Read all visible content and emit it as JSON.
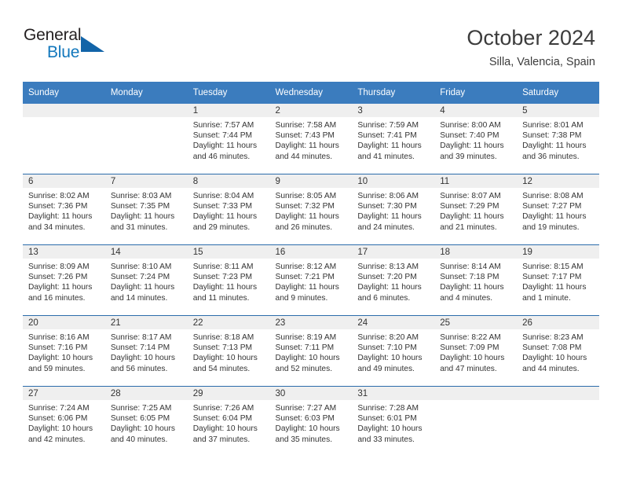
{
  "brand": {
    "name_top": "General",
    "name_bottom": "Blue",
    "color_top": "#231f20",
    "color_bottom": "#1277bc",
    "triangle_color": "#1264a8"
  },
  "header": {
    "title": "October 2024",
    "location": "Silla, Valencia, Spain"
  },
  "theme": {
    "header_bg": "#3b7cbe",
    "row_divider": "#2b6cab",
    "daynum_band_bg": "#efefef",
    "text": "#333333"
  },
  "weekdays": [
    "Sunday",
    "Monday",
    "Tuesday",
    "Wednesday",
    "Thursday",
    "Friday",
    "Saturday"
  ],
  "weeks": [
    [
      {
        "day": "",
        "sunrise": "",
        "sunset": "",
        "daylight_line1": "",
        "daylight_line2": ""
      },
      {
        "day": "",
        "sunrise": "",
        "sunset": "",
        "daylight_line1": "",
        "daylight_line2": ""
      },
      {
        "day": "1",
        "sunrise": "Sunrise: 7:57 AM",
        "sunset": "Sunset: 7:44 PM",
        "daylight_line1": "Daylight: 11 hours",
        "daylight_line2": "and 46 minutes."
      },
      {
        "day": "2",
        "sunrise": "Sunrise: 7:58 AM",
        "sunset": "Sunset: 7:43 PM",
        "daylight_line1": "Daylight: 11 hours",
        "daylight_line2": "and 44 minutes."
      },
      {
        "day": "3",
        "sunrise": "Sunrise: 7:59 AM",
        "sunset": "Sunset: 7:41 PM",
        "daylight_line1": "Daylight: 11 hours",
        "daylight_line2": "and 41 minutes."
      },
      {
        "day": "4",
        "sunrise": "Sunrise: 8:00 AM",
        "sunset": "Sunset: 7:40 PM",
        "daylight_line1": "Daylight: 11 hours",
        "daylight_line2": "and 39 minutes."
      },
      {
        "day": "5",
        "sunrise": "Sunrise: 8:01 AM",
        "sunset": "Sunset: 7:38 PM",
        "daylight_line1": "Daylight: 11 hours",
        "daylight_line2": "and 36 minutes."
      }
    ],
    [
      {
        "day": "6",
        "sunrise": "Sunrise: 8:02 AM",
        "sunset": "Sunset: 7:36 PM",
        "daylight_line1": "Daylight: 11 hours",
        "daylight_line2": "and 34 minutes."
      },
      {
        "day": "7",
        "sunrise": "Sunrise: 8:03 AM",
        "sunset": "Sunset: 7:35 PM",
        "daylight_line1": "Daylight: 11 hours",
        "daylight_line2": "and 31 minutes."
      },
      {
        "day": "8",
        "sunrise": "Sunrise: 8:04 AM",
        "sunset": "Sunset: 7:33 PM",
        "daylight_line1": "Daylight: 11 hours",
        "daylight_line2": "and 29 minutes."
      },
      {
        "day": "9",
        "sunrise": "Sunrise: 8:05 AM",
        "sunset": "Sunset: 7:32 PM",
        "daylight_line1": "Daylight: 11 hours",
        "daylight_line2": "and 26 minutes."
      },
      {
        "day": "10",
        "sunrise": "Sunrise: 8:06 AM",
        "sunset": "Sunset: 7:30 PM",
        "daylight_line1": "Daylight: 11 hours",
        "daylight_line2": "and 24 minutes."
      },
      {
        "day": "11",
        "sunrise": "Sunrise: 8:07 AM",
        "sunset": "Sunset: 7:29 PM",
        "daylight_line1": "Daylight: 11 hours",
        "daylight_line2": "and 21 minutes."
      },
      {
        "day": "12",
        "sunrise": "Sunrise: 8:08 AM",
        "sunset": "Sunset: 7:27 PM",
        "daylight_line1": "Daylight: 11 hours",
        "daylight_line2": "and 19 minutes."
      }
    ],
    [
      {
        "day": "13",
        "sunrise": "Sunrise: 8:09 AM",
        "sunset": "Sunset: 7:26 PM",
        "daylight_line1": "Daylight: 11 hours",
        "daylight_line2": "and 16 minutes."
      },
      {
        "day": "14",
        "sunrise": "Sunrise: 8:10 AM",
        "sunset": "Sunset: 7:24 PM",
        "daylight_line1": "Daylight: 11 hours",
        "daylight_line2": "and 14 minutes."
      },
      {
        "day": "15",
        "sunrise": "Sunrise: 8:11 AM",
        "sunset": "Sunset: 7:23 PM",
        "daylight_line1": "Daylight: 11 hours",
        "daylight_line2": "and 11 minutes."
      },
      {
        "day": "16",
        "sunrise": "Sunrise: 8:12 AM",
        "sunset": "Sunset: 7:21 PM",
        "daylight_line1": "Daylight: 11 hours",
        "daylight_line2": "and 9 minutes."
      },
      {
        "day": "17",
        "sunrise": "Sunrise: 8:13 AM",
        "sunset": "Sunset: 7:20 PM",
        "daylight_line1": "Daylight: 11 hours",
        "daylight_line2": "and 6 minutes."
      },
      {
        "day": "18",
        "sunrise": "Sunrise: 8:14 AM",
        "sunset": "Sunset: 7:18 PM",
        "daylight_line1": "Daylight: 11 hours",
        "daylight_line2": "and 4 minutes."
      },
      {
        "day": "19",
        "sunrise": "Sunrise: 8:15 AM",
        "sunset": "Sunset: 7:17 PM",
        "daylight_line1": "Daylight: 11 hours",
        "daylight_line2": "and 1 minute."
      }
    ],
    [
      {
        "day": "20",
        "sunrise": "Sunrise: 8:16 AM",
        "sunset": "Sunset: 7:16 PM",
        "daylight_line1": "Daylight: 10 hours",
        "daylight_line2": "and 59 minutes."
      },
      {
        "day": "21",
        "sunrise": "Sunrise: 8:17 AM",
        "sunset": "Sunset: 7:14 PM",
        "daylight_line1": "Daylight: 10 hours",
        "daylight_line2": "and 56 minutes."
      },
      {
        "day": "22",
        "sunrise": "Sunrise: 8:18 AM",
        "sunset": "Sunset: 7:13 PM",
        "daylight_line1": "Daylight: 10 hours",
        "daylight_line2": "and 54 minutes."
      },
      {
        "day": "23",
        "sunrise": "Sunrise: 8:19 AM",
        "sunset": "Sunset: 7:11 PM",
        "daylight_line1": "Daylight: 10 hours",
        "daylight_line2": "and 52 minutes."
      },
      {
        "day": "24",
        "sunrise": "Sunrise: 8:20 AM",
        "sunset": "Sunset: 7:10 PM",
        "daylight_line1": "Daylight: 10 hours",
        "daylight_line2": "and 49 minutes."
      },
      {
        "day": "25",
        "sunrise": "Sunrise: 8:22 AM",
        "sunset": "Sunset: 7:09 PM",
        "daylight_line1": "Daylight: 10 hours",
        "daylight_line2": "and 47 minutes."
      },
      {
        "day": "26",
        "sunrise": "Sunrise: 8:23 AM",
        "sunset": "Sunset: 7:08 PM",
        "daylight_line1": "Daylight: 10 hours",
        "daylight_line2": "and 44 minutes."
      }
    ],
    [
      {
        "day": "27",
        "sunrise": "Sunrise: 7:24 AM",
        "sunset": "Sunset: 6:06 PM",
        "daylight_line1": "Daylight: 10 hours",
        "daylight_line2": "and 42 minutes."
      },
      {
        "day": "28",
        "sunrise": "Sunrise: 7:25 AM",
        "sunset": "Sunset: 6:05 PM",
        "daylight_line1": "Daylight: 10 hours",
        "daylight_line2": "and 40 minutes."
      },
      {
        "day": "29",
        "sunrise": "Sunrise: 7:26 AM",
        "sunset": "Sunset: 6:04 PM",
        "daylight_line1": "Daylight: 10 hours",
        "daylight_line2": "and 37 minutes."
      },
      {
        "day": "30",
        "sunrise": "Sunrise: 7:27 AM",
        "sunset": "Sunset: 6:03 PM",
        "daylight_line1": "Daylight: 10 hours",
        "daylight_line2": "and 35 minutes."
      },
      {
        "day": "31",
        "sunrise": "Sunrise: 7:28 AM",
        "sunset": "Sunset: 6:01 PM",
        "daylight_line1": "Daylight: 10 hours",
        "daylight_line2": "and 33 minutes."
      },
      {
        "day": "",
        "sunrise": "",
        "sunset": "",
        "daylight_line1": "",
        "daylight_line2": ""
      },
      {
        "day": "",
        "sunrise": "",
        "sunset": "",
        "daylight_line1": "",
        "daylight_line2": ""
      }
    ]
  ]
}
